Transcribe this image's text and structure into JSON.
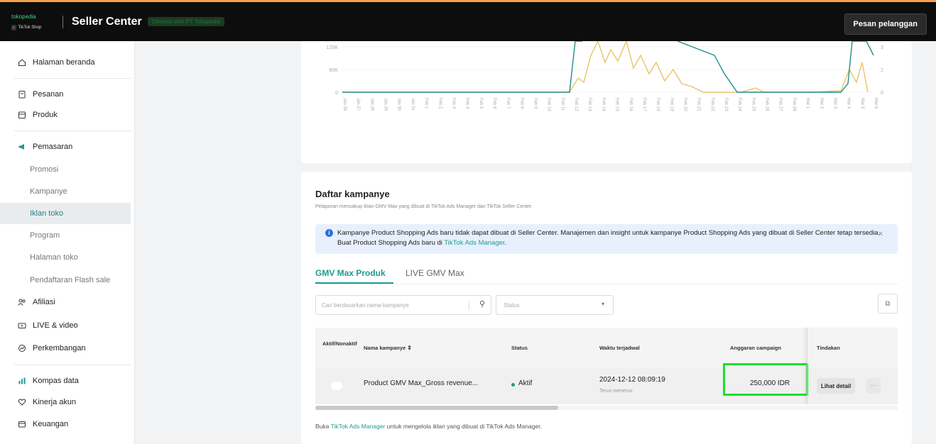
{
  "topbar": {
    "logo_line1": "tokopedia",
    "logo_line2": "TikTok Shop",
    "title": "Seller Center",
    "subtitle": "Dikelola oleh PT Tokopedia",
    "customer_msg_button": "Pesan pelanggan"
  },
  "sidebar": {
    "items": [
      {
        "label": "Halaman beranda",
        "icon": "home-icon"
      },
      {
        "label": "Pesanan",
        "icon": "clipboard-icon"
      },
      {
        "label": "Produk",
        "icon": "box-icon"
      },
      {
        "label": "Pemasaran",
        "icon": "megaphone-icon"
      },
      {
        "label": "Promosi"
      },
      {
        "label": "Kampanye"
      },
      {
        "label": "Iklan toko"
      },
      {
        "label": "Program"
      },
      {
        "label": "Halaman toko"
      },
      {
        "label": "Pendaftaran Flash sale"
      },
      {
        "label": "Afiliasi",
        "icon": "people-icon"
      },
      {
        "label": "LIVE & video",
        "icon": "video-icon"
      },
      {
        "label": "Perkembangan",
        "icon": "growth-icon"
      },
      {
        "label": "Kompas data",
        "icon": "chart-icon"
      },
      {
        "label": "Kinerja akun",
        "icon": "heart-icon"
      },
      {
        "label": "Keuangan",
        "icon": "wallet-icon"
      }
    ]
  },
  "chart": {
    "y_left_ticks": [
      "120K",
      "60K",
      "0"
    ],
    "y_right_ticks": [
      "3",
      "2",
      "0"
    ],
    "x_labels": [
      "Jan 26",
      "Jan 27",
      "Jan 28",
      "Jan 29",
      "Jan 30",
      "Jan 31",
      "Feb 1",
      "Feb 2",
      "Feb 3",
      "Feb 4",
      "Feb 5",
      "Feb 6",
      "Feb 7",
      "Feb 8",
      "Feb 9",
      "Feb 10",
      "Feb 11",
      "Feb 12",
      "Feb 13",
      "Feb 14",
      "Feb 15",
      "Feb 16",
      "Feb 17",
      "Feb 18",
      "Feb 19",
      "Feb 20",
      "Feb 21",
      "Feb 22",
      "Feb 23",
      "Feb 24",
      "Feb 25",
      "Feb 26",
      "Feb 27",
      "Feb 28",
      "Mar 1",
      "Mar 2",
      "Mar 3",
      "Mar 4",
      "Mar 5",
      "Mar 6"
    ],
    "colors": {
      "series_a": "#e8c468",
      "series_b": "#1f8f8a"
    }
  },
  "campaigns": {
    "title": "Daftar kampanye",
    "description": "Pelaporan mencakup iklan GMV Max yang dibuat di TikTok Ads Manager dan TikTok Seller Center.",
    "banner_text": "Kampanye Product Shopping Ads baru tidak dapat dibuat di Seller Center. Manajemen dan insight untuk kampanye Product Shopping Ads yang dibuat di Seller Center tetap tersedia. Buat Product Shopping Ads baru di ",
    "banner_link": "TikTok Ads Manager",
    "banner_end": ".",
    "tabs": [
      {
        "label": "GMV Max Produk"
      },
      {
        "label": "LIVE GMV Max"
      }
    ],
    "search_placeholder": "Cari berdasarkan nama kampanye",
    "status_placeholder": "Status",
    "columns": [
      "Aktif/Nonaktif",
      "Nama kampanye",
      "Status",
      "Waktu terjadwal",
      "Anggaran campaign",
      "Tindakan"
    ],
    "rows": [
      {
        "name": "Product GMV Max_Gross revenue...",
        "status": "Aktif",
        "scheduled": "2024-12-12 08:09:19",
        "scheduled_sub": "Terus-menerus",
        "budget": "250,000 IDR",
        "action": "Lihat detail",
        "more": "···"
      }
    ],
    "footer_pre": "Buka ",
    "footer_link": "TikTok Ads Manager",
    "footer_post": " untuk mengelola iklan yang dibuat di TikTok Ads Manager."
  }
}
